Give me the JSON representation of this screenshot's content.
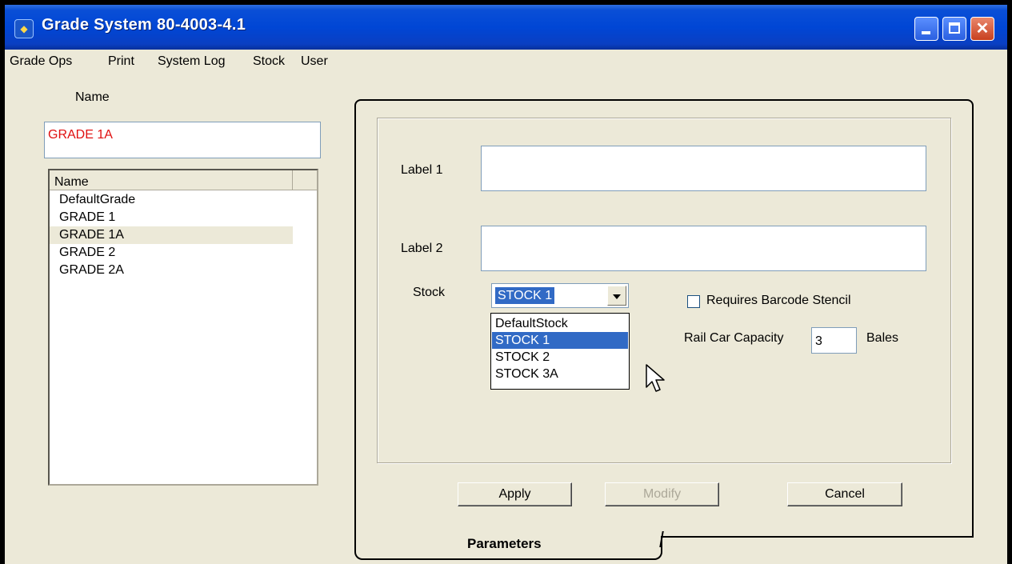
{
  "window": {
    "title": "Grade System 80-4003-4.1"
  },
  "menu": [
    "Grade Ops",
    "Print",
    "System Log",
    "Stock",
    "User"
  ],
  "name_label": "Name",
  "name_input_value": "GRADE 1A",
  "grade_list": {
    "header": "Name",
    "items": [
      "DefaultGrade",
      "GRADE 1",
      "GRADE 1A",
      "GRADE 2",
      "GRADE 2A"
    ],
    "selected": "GRADE 1A"
  },
  "form": {
    "label1_caption": "Label 1",
    "label1_value": "",
    "label2_caption": "Label 2",
    "label2_value": "",
    "stock_caption": "Stock",
    "stock_selected": "STOCK 1",
    "stock_options": [
      "DefaultStock",
      "STOCK 1",
      "STOCK 2",
      "STOCK 3A"
    ],
    "requires_barcode_label": "Requires Barcode Stencil",
    "requires_barcode_checked": false,
    "rail_car_capacity_label": "Rail Car Capacity",
    "rail_car_capacity_value": "3",
    "bales_label": "Bales"
  },
  "buttons": {
    "apply": "Apply",
    "modify": "Modify",
    "cancel": "Cancel"
  },
  "tab_label": "Parameters"
}
